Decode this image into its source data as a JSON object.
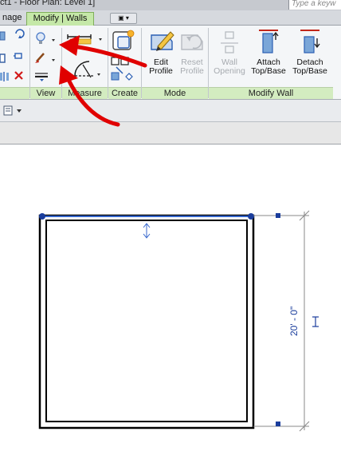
{
  "window": {
    "title": "ct1 - Floor Plan: Level 1]",
    "search_placeholder": "Type a keyw"
  },
  "tabs": [
    {
      "label": "nage",
      "active": false
    },
    {
      "label": "Modify | Walls",
      "active": true
    },
    {
      "label": "▣ ▾",
      "active": false
    }
  ],
  "ribbon": {
    "panels": [
      {
        "label": "View"
      },
      {
        "label": "Measure"
      },
      {
        "label": "Create"
      },
      {
        "label": "Mode"
      },
      {
        "label": "Modify Wall"
      }
    ],
    "buttons": {
      "edit_profile": {
        "line1": "Edit",
        "line2": "Profile",
        "enabled": true
      },
      "reset_profile": {
        "line1": "Reset",
        "line2": "Profile",
        "enabled": false
      },
      "wall_opening": {
        "line1": "Wall",
        "line2": "Opening",
        "enabled": false
      },
      "attach_top_base": {
        "line1": "Attach",
        "line2": "Top/Base",
        "enabled": true
      },
      "detach_top_base": {
        "line1": "Detach",
        "line2": "Top/Base",
        "enabled": true
      }
    }
  },
  "drawing": {
    "dimension_text": "20' - 0\"",
    "annotation_color": "#e00000",
    "selection_color": "#1a3d9c"
  }
}
